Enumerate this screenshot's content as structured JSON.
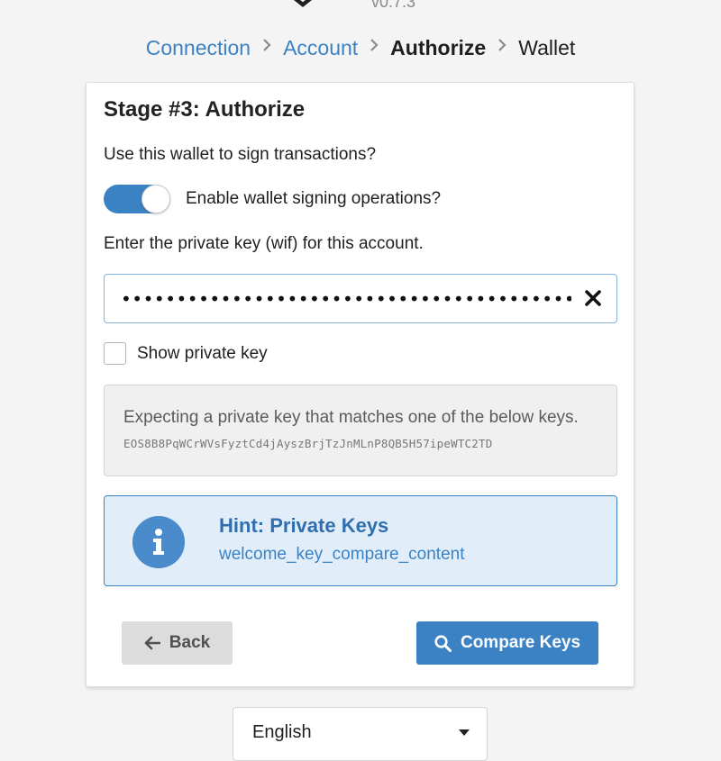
{
  "header": {
    "logo_icon": "diamond-logo-icon",
    "version": "v0.7.3"
  },
  "breadcrumb": {
    "items": [
      "Connection",
      "Account",
      "Authorize",
      "Wallet"
    ],
    "active": "Authorize"
  },
  "stage": {
    "title": "Stage #3: Authorize",
    "question": "Use this wallet to sign transactions?",
    "toggle": {
      "label": "Enable wallet signing operations?",
      "on": true
    },
    "key_label": "Enter the private key (wif) for this account.",
    "key_input": {
      "value": "•••••••••••••••••••••••••••••••••••••••••••",
      "type": "password"
    },
    "show_key": {
      "label": "Show private key",
      "checked": false
    },
    "expect": {
      "text": "Expecting a private key that matches one of the below keys.",
      "public_key": "EOS8B8PqWCrWVsFyztCd4jAyszBrjTzJnMLnP8QB5H57ipeWTC2TD"
    },
    "hint": {
      "icon": "info-icon",
      "title": "Hint: Private Keys",
      "content": "welcome_key_compare_content"
    },
    "buttons": {
      "back": "Back",
      "compare": "Compare Keys"
    }
  },
  "language": {
    "selected": "English"
  },
  "colors": {
    "accent": "#3b82c4",
    "hint_bg": "#e1eefa",
    "background": "#f4f4f4"
  }
}
